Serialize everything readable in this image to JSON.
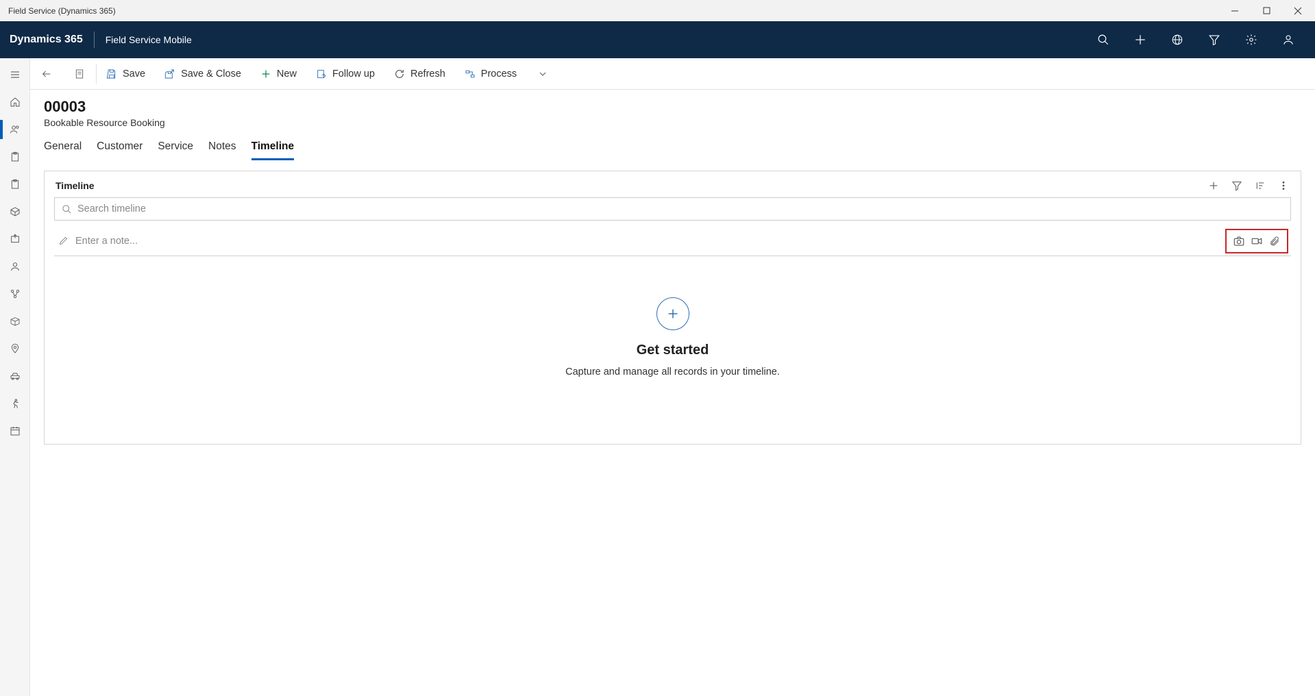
{
  "window": {
    "title": "Field Service (Dynamics 365)"
  },
  "topnav": {
    "brand": "Dynamics 365",
    "app_name": "Field Service Mobile"
  },
  "commandbar": {
    "save": "Save",
    "save_close": "Save & Close",
    "new": "New",
    "follow_up": "Follow up",
    "refresh": "Refresh",
    "process": "Process"
  },
  "record": {
    "title": "00003",
    "subtitle": "Bookable Resource Booking"
  },
  "tabs": {
    "general": "General",
    "customer": "Customer",
    "service": "Service",
    "notes": "Notes",
    "timeline": "Timeline",
    "active": "timeline"
  },
  "timeline": {
    "title": "Timeline",
    "search_placeholder": "Search timeline",
    "note_placeholder": "Enter a note...",
    "empty_title": "Get started",
    "empty_subtitle": "Capture and manage all records in your timeline."
  }
}
